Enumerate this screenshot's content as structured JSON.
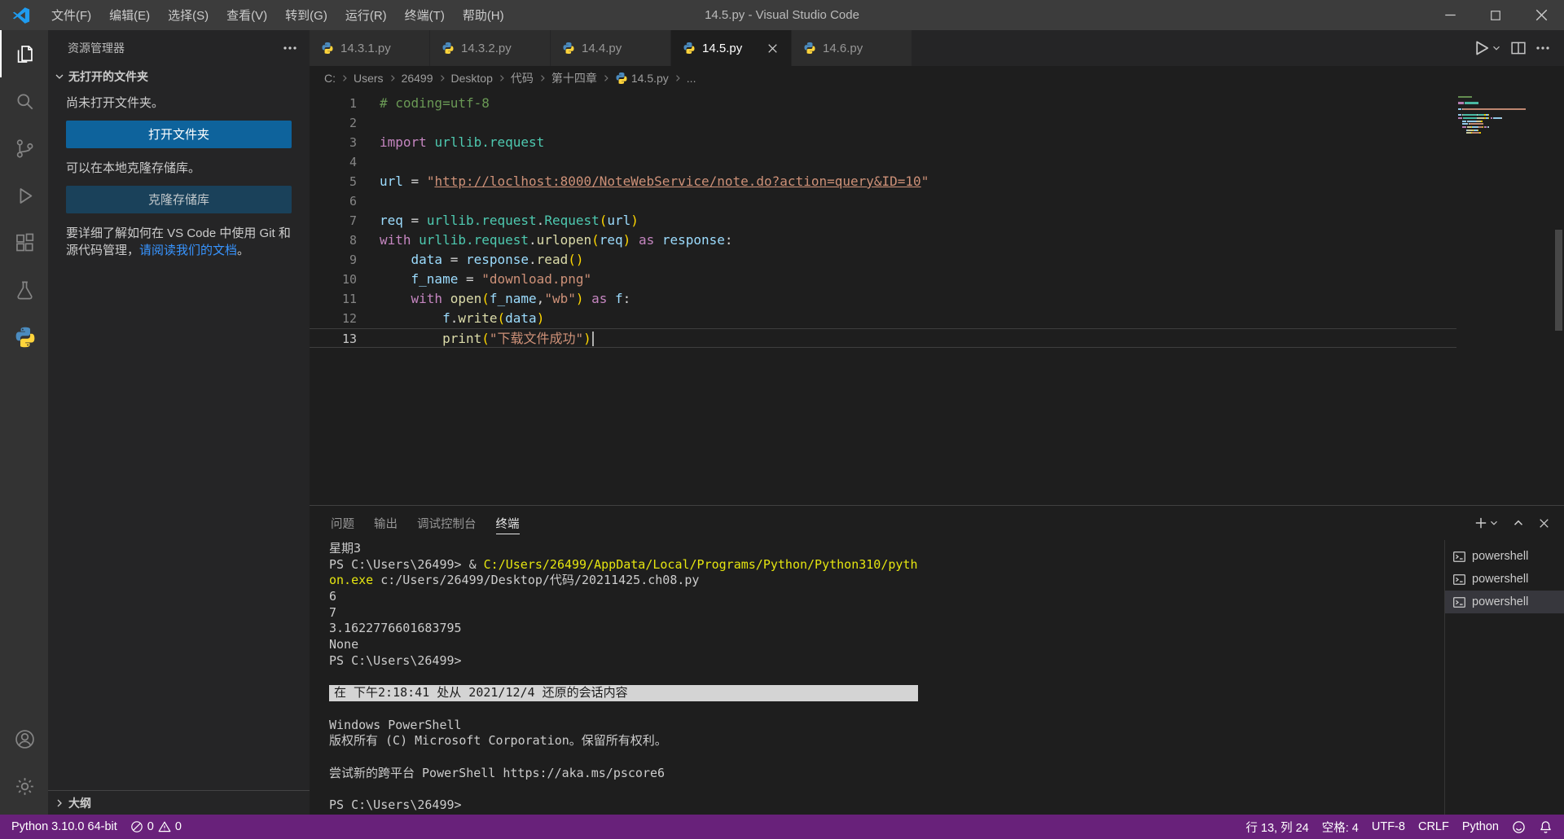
{
  "window": {
    "title": "14.5.py - Visual Studio Code"
  },
  "titlebar": {
    "menus": [
      "文件(F)",
      "编辑(E)",
      "选择(S)",
      "查看(V)",
      "转到(G)",
      "运行(R)",
      "终端(T)",
      "帮助(H)"
    ]
  },
  "activitybar": {
    "items": [
      {
        "name": "explorer",
        "icon": "explorer",
        "active": true
      },
      {
        "name": "search",
        "icon": "search"
      },
      {
        "name": "source-control",
        "icon": "scm"
      },
      {
        "name": "run-and-debug",
        "icon": "run"
      },
      {
        "name": "extensions",
        "icon": "extensions"
      },
      {
        "name": "testing",
        "icon": "testing"
      },
      {
        "name": "python",
        "icon": "python"
      }
    ],
    "bottom": [
      {
        "name": "accounts",
        "icon": "account"
      },
      {
        "name": "manage",
        "icon": "gear"
      }
    ]
  },
  "sidebar": {
    "header": "资源管理器",
    "section": "无打开的文件夹",
    "no_folder_text": "尚未打开文件夹。",
    "open_folder_button": "打开文件夹",
    "clone_text": "可以在本地克隆存储库。",
    "clone_button": "克隆存储库",
    "git_text_pre": "要详细了解如何在 VS Code 中使用 Git 和源代码管理，",
    "git_link": "请阅读我们的文档",
    "git_text_post": "。",
    "outline": "大纲"
  },
  "tabs": [
    {
      "label": "14.3.1.py"
    },
    {
      "label": "14.3.2.py"
    },
    {
      "label": "14.4.py"
    },
    {
      "label": "14.5.py",
      "active": true
    },
    {
      "label": "14.6.py"
    }
  ],
  "breadcrumbs": {
    "items": [
      {
        "label": "C:"
      },
      {
        "label": "Users"
      },
      {
        "label": "26499"
      },
      {
        "label": "Desktop"
      },
      {
        "label": "代码"
      },
      {
        "label": "第十四章"
      },
      {
        "label": "14.5.py",
        "icon": "python-small"
      },
      {
        "label": "..."
      }
    ]
  },
  "editor": {
    "current_line": 13,
    "lines": [
      {
        "n": "1",
        "tokens": [
          {
            "c": "comment",
            "t": "# coding=utf-8"
          }
        ]
      },
      {
        "n": "2",
        "tokens": []
      },
      {
        "n": "3",
        "tokens": [
          {
            "c": "kw",
            "t": "import"
          },
          {
            "c": "plain",
            "t": " "
          },
          {
            "c": "mod",
            "t": "urllib.request"
          }
        ]
      },
      {
        "n": "4",
        "tokens": []
      },
      {
        "n": "5",
        "tokens": [
          {
            "c": "var",
            "t": "url"
          },
          {
            "c": "plain",
            "t": " = "
          },
          {
            "c": "str",
            "t": "\""
          },
          {
            "c": "strlink",
            "t": "http://loclhost:8000/NoteWebService/note.do?action=query&ID=10"
          },
          {
            "c": "str",
            "t": "\""
          }
        ]
      },
      {
        "n": "6",
        "tokens": []
      },
      {
        "n": "7",
        "tokens": [
          {
            "c": "var",
            "t": "req"
          },
          {
            "c": "plain",
            "t": " = "
          },
          {
            "c": "mod",
            "t": "urllib.request"
          },
          {
            "c": "plain",
            "t": "."
          },
          {
            "c": "mod",
            "t": "Request"
          },
          {
            "c": "br",
            "t": "("
          },
          {
            "c": "var",
            "t": "url"
          },
          {
            "c": "br",
            "t": ")"
          }
        ]
      },
      {
        "n": "8",
        "tokens": [
          {
            "c": "kw",
            "t": "with"
          },
          {
            "c": "plain",
            "t": " "
          },
          {
            "c": "mod",
            "t": "urllib.request"
          },
          {
            "c": "plain",
            "t": "."
          },
          {
            "c": "fn",
            "t": "urlopen"
          },
          {
            "c": "br",
            "t": "("
          },
          {
            "c": "var",
            "t": "req"
          },
          {
            "c": "br",
            "t": ")"
          },
          {
            "c": "plain",
            "t": " "
          },
          {
            "c": "kw",
            "t": "as"
          },
          {
            "c": "plain",
            "t": " "
          },
          {
            "c": "var",
            "t": "response"
          },
          {
            "c": "plain",
            "t": ":"
          }
        ]
      },
      {
        "n": "9",
        "tokens": [
          {
            "c": "plain",
            "t": "    "
          },
          {
            "c": "var",
            "t": "data"
          },
          {
            "c": "plain",
            "t": " = "
          },
          {
            "c": "var",
            "t": "response"
          },
          {
            "c": "plain",
            "t": "."
          },
          {
            "c": "fn",
            "t": "read"
          },
          {
            "c": "br",
            "t": "()"
          }
        ]
      },
      {
        "n": "10",
        "tokens": [
          {
            "c": "plain",
            "t": "    "
          },
          {
            "c": "var",
            "t": "f_name"
          },
          {
            "c": "plain",
            "t": " = "
          },
          {
            "c": "str",
            "t": "\"download.png\""
          }
        ]
      },
      {
        "n": "11",
        "tokens": [
          {
            "c": "plain",
            "t": "    "
          },
          {
            "c": "kw",
            "t": "with"
          },
          {
            "c": "plain",
            "t": " "
          },
          {
            "c": "fn",
            "t": "open"
          },
          {
            "c": "br",
            "t": "("
          },
          {
            "c": "var",
            "t": "f_name"
          },
          {
            "c": "plain",
            "t": ","
          },
          {
            "c": "str",
            "t": "\"wb\""
          },
          {
            "c": "br",
            "t": ")"
          },
          {
            "c": "plain",
            "t": " "
          },
          {
            "c": "kw",
            "t": "as"
          },
          {
            "c": "plain",
            "t": " "
          },
          {
            "c": "var",
            "t": "f"
          },
          {
            "c": "plain",
            "t": ":"
          }
        ]
      },
      {
        "n": "12",
        "tokens": [
          {
            "c": "plain",
            "t": "        "
          },
          {
            "c": "var",
            "t": "f"
          },
          {
            "c": "plain",
            "t": "."
          },
          {
            "c": "fn",
            "t": "write"
          },
          {
            "c": "br",
            "t": "("
          },
          {
            "c": "var",
            "t": "data"
          },
          {
            "c": "br",
            "t": ")"
          }
        ]
      },
      {
        "n": "13",
        "tokens": [
          {
            "c": "plain",
            "t": "        "
          },
          {
            "c": "fn",
            "t": "print"
          },
          {
            "c": "br",
            "t": "("
          },
          {
            "c": "str",
            "t": "\"下载文件成功\""
          },
          {
            "c": "br",
            "t": ")"
          }
        ]
      }
    ]
  },
  "panel": {
    "tabs": [
      "问题",
      "输出",
      "调试控制台",
      "终端"
    ],
    "active_tab": "终端"
  },
  "terminal": {
    "lines": [
      {
        "segs": [
          {
            "c": "plain",
            "t": "星期3"
          }
        ]
      },
      {
        "segs": [
          {
            "c": "plain",
            "t": "PS C:\\Users\\26499> & "
          },
          {
            "c": "cmd",
            "t": "C:/Users/26499/AppData/Local/Programs/Python/Python310/pyth"
          }
        ]
      },
      {
        "segs": [
          {
            "c": "cmd",
            "t": "on.exe"
          },
          {
            "c": "plain",
            "t": " c:/Users/26499/Desktop/代码/20211425.ch08.py"
          }
        ]
      },
      {
        "segs": [
          {
            "c": "plain",
            "t": "6"
          }
        ]
      },
      {
        "segs": [
          {
            "c": "plain",
            "t": "7"
          }
        ]
      },
      {
        "segs": [
          {
            "c": "plain",
            "t": "3.1622776601683795"
          }
        ]
      },
      {
        "segs": [
          {
            "c": "plain",
            "t": "None"
          }
        ]
      },
      {
        "segs": [
          {
            "c": "plain",
            "t": "PS C:\\Users\\26499>"
          }
        ]
      },
      {
        "segs": []
      },
      {
        "segs": [
          {
            "c": "restore",
            "t": "在 下午2:18:41 处从 2021/12/4 还原的会话内容 "
          }
        ]
      },
      {
        "segs": []
      },
      {
        "segs": [
          {
            "c": "plain",
            "t": "Windows PowerShell"
          }
        ]
      },
      {
        "segs": [
          {
            "c": "plain",
            "t": "版权所有 (C) Microsoft Corporation。保留所有权利。"
          }
        ]
      },
      {
        "segs": []
      },
      {
        "segs": [
          {
            "c": "plain",
            "t": "尝试新的跨平台 PowerShell https://aka.ms/pscore6"
          }
        ]
      },
      {
        "segs": []
      },
      {
        "segs": [
          {
            "c": "plain",
            "t": "PS C:\\Users\\26499>"
          }
        ]
      }
    ],
    "list": [
      {
        "label": "powershell"
      },
      {
        "label": "powershell"
      },
      {
        "label": "powershell",
        "selected": true
      }
    ]
  },
  "statusbar": {
    "python_version": "Python 3.10.0 64-bit",
    "errors": "0",
    "warnings": "0",
    "cursor": "行 13, 列 24",
    "indent": "空格: 4",
    "encoding": "UTF-8",
    "eol": "CRLF",
    "language": "Python"
  },
  "colors": {
    "accent_blue": "#0e639c",
    "statusbar": "#68217A",
    "link": "#3794ff",
    "token": {
      "comment": "#6A9955",
      "kw": "#C586C0",
      "mod": "#4EC9B0",
      "fn": "#DCDCAA",
      "var": "#9CDCFE",
      "str": "#CE9178",
      "strlink": "#CE9178",
      "br": "#FFD700",
      "plain": "#D4D4D4",
      "cmd": "#E5E510"
    }
  }
}
